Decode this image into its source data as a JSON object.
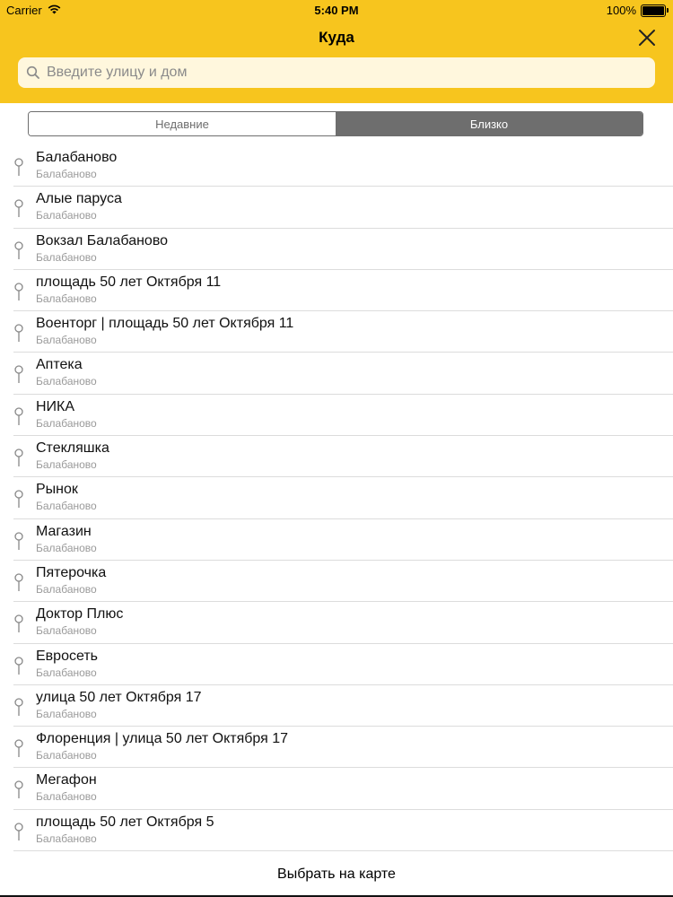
{
  "status_bar": {
    "carrier": "Carrier",
    "time": "5:40 PM",
    "battery": "100%"
  },
  "header": {
    "title": "Куда",
    "close_icon": "close-icon"
  },
  "search": {
    "placeholder": "Введите улицу и дом",
    "value": ""
  },
  "tabs": [
    {
      "label": "Недавние",
      "selected": false
    },
    {
      "label": "Близко",
      "selected": true
    }
  ],
  "places": [
    {
      "title": "Балабаново",
      "subtitle": "Балабаново"
    },
    {
      "title": "Алые паруса",
      "subtitle": "Балабаново"
    },
    {
      "title": "Вокзал Балабаново",
      "subtitle": "Балабаново"
    },
    {
      "title": "площадь 50 лет Октября 11",
      "subtitle": "Балабаново"
    },
    {
      "title": "Военторг | площадь 50 лет Октября 11",
      "subtitle": "Балабаново"
    },
    {
      "title": "Аптека",
      "subtitle": "Балабаново"
    },
    {
      "title": "НИКА",
      "subtitle": "Балабаново"
    },
    {
      "title": "Стекляшка",
      "subtitle": "Балабаново"
    },
    {
      "title": "Рынок",
      "subtitle": "Балабаново"
    },
    {
      "title": "Магазин",
      "subtitle": "Балабаново"
    },
    {
      "title": "Пятерочка",
      "subtitle": "Балабаново"
    },
    {
      "title": "Доктор Плюс",
      "subtitle": "Балабаново"
    },
    {
      "title": "Евросеть",
      "subtitle": "Балабаново"
    },
    {
      "title": "улица 50 лет Октября 17",
      "subtitle": "Балабаново"
    },
    {
      "title": "Флоренция | улица 50 лет Октября 17",
      "subtitle": "Балабаново"
    },
    {
      "title": "Мегафон",
      "subtitle": "Балабаново"
    },
    {
      "title": "площадь 50 лет Октября 5",
      "subtitle": "Балабаново"
    }
  ],
  "footer": {
    "label": "Выбрать на карте"
  },
  "colors": {
    "accent": "#f7c51e",
    "segment_selected": "#6e6e6e"
  }
}
